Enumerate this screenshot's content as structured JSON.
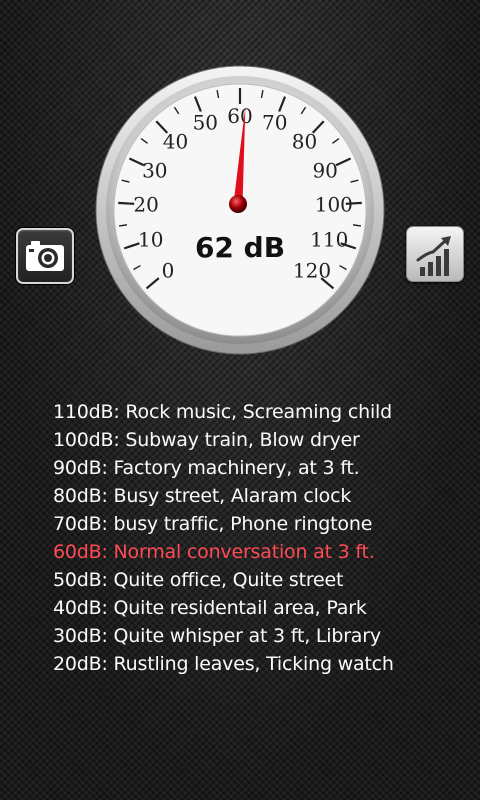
{
  "meter": {
    "reading_text": "62 dB",
    "value_db": 62,
    "scale_min": 0,
    "scale_max": 120,
    "tick_labels": [
      "0",
      "10",
      "20",
      "30",
      "40",
      "50",
      "60",
      "70",
      "80",
      "90",
      "100",
      "110",
      "120"
    ]
  },
  "buttons": {
    "camera_icon": "camera-icon",
    "stats_icon": "bar-chart-trend-icon"
  },
  "levels": [
    {
      "text": "110dB: Rock music, Screaming child",
      "active": false
    },
    {
      "text": "100dB: Subway train, Blow dryer",
      "active": false
    },
    {
      "text": "90dB: Factory machinery, at 3 ft.",
      "active": false
    },
    {
      "text": "80dB: Busy street, Alaram clock",
      "active": false
    },
    {
      "text": "70dB: busy traffic, Phone ringtone",
      "active": false
    },
    {
      "text": "60dB: Normal conversation at 3 ft.",
      "active": true
    },
    {
      "text": "50dB: Quite office, Quite street",
      "active": false
    },
    {
      "text": "40dB: Quite residentail area, Park",
      "active": false
    },
    {
      "text": "30dB: Quite whisper at 3 ft, Library",
      "active": false
    },
    {
      "text": "20dB: Rustling leaves, Ticking watch",
      "active": false
    }
  ],
  "colors": {
    "needle": "#e0101a",
    "active_text": "#ff4b55",
    "text": "#fafafa"
  }
}
